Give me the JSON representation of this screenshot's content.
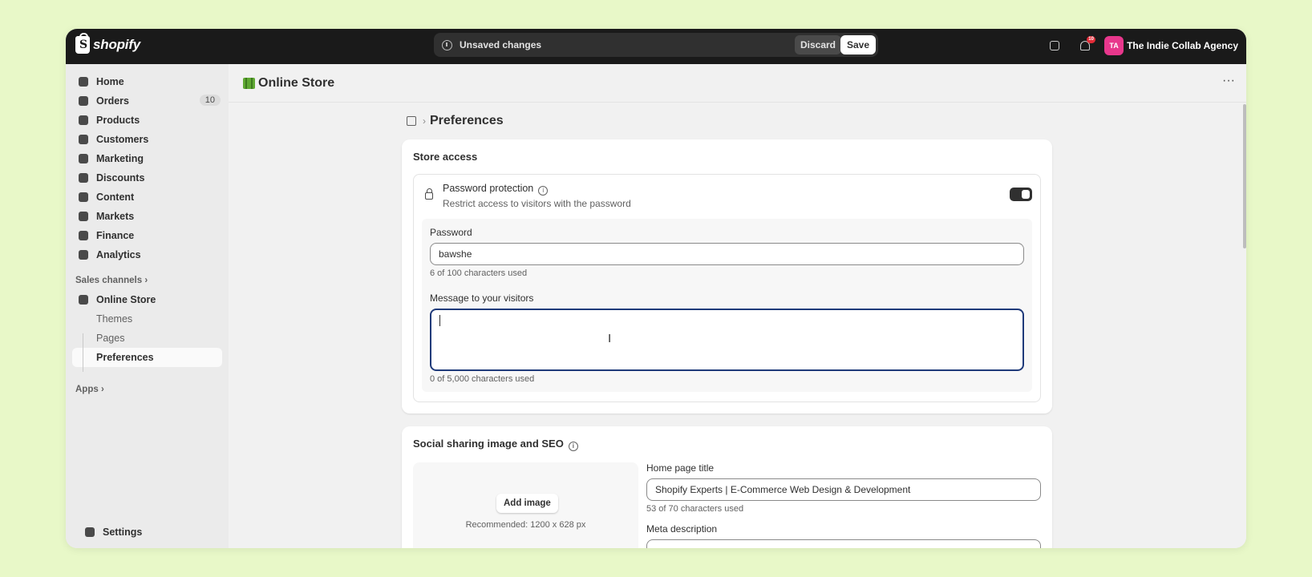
{
  "topbar": {
    "logo_text": "shopify",
    "unsaved_label": "Unsaved changes",
    "discard_label": "Discard",
    "save_label": "Save",
    "notification_count": "10",
    "avatar_initials": "TA",
    "store_name": "The Indie Collab Agency"
  },
  "sidebar": {
    "items": [
      {
        "label": "Home"
      },
      {
        "label": "Orders",
        "count": "10"
      },
      {
        "label": "Products"
      },
      {
        "label": "Customers"
      },
      {
        "label": "Marketing"
      },
      {
        "label": "Discounts"
      },
      {
        "label": "Content"
      },
      {
        "label": "Markets"
      },
      {
        "label": "Finance"
      },
      {
        "label": "Analytics"
      }
    ],
    "sales_channels_label": "Sales channels",
    "online_store_label": "Online Store",
    "sub_items": [
      "Themes",
      "Pages",
      "Preferences"
    ],
    "apps_label": "Apps",
    "settings_label": "Settings"
  },
  "header": {
    "title": "Online Store",
    "more_label": "···"
  },
  "breadcrumb": {
    "separator": "›",
    "title": "Preferences"
  },
  "store_access": {
    "title": "Store access",
    "password_protection_title": "Password protection",
    "password_protection_desc": "Restrict access to visitors with the password",
    "toggle_on": true,
    "password_label": "Password",
    "password_value": "bawshe",
    "password_help": "6 of 100 characters used",
    "message_label": "Message to your visitors",
    "message_value": "",
    "message_help": "0 of 5,000 characters used"
  },
  "seo": {
    "title": "Social sharing image and SEO",
    "add_image_label": "Add image",
    "recommended_text": "Recommended: 1200 x 628 px",
    "home_title_label": "Home page title",
    "home_title_value": "Shopify Experts | E-Commerce Web Design & Development",
    "home_title_help": "53 of 70 characters used",
    "meta_description_label": "Meta description"
  },
  "colors": {
    "topbar_bg": "#1a1a1a",
    "page_bg": "#e8f8c8",
    "avatar": "#e8378c",
    "focus_border": "#1f3a7a",
    "notification_badge": "#e22c38"
  }
}
